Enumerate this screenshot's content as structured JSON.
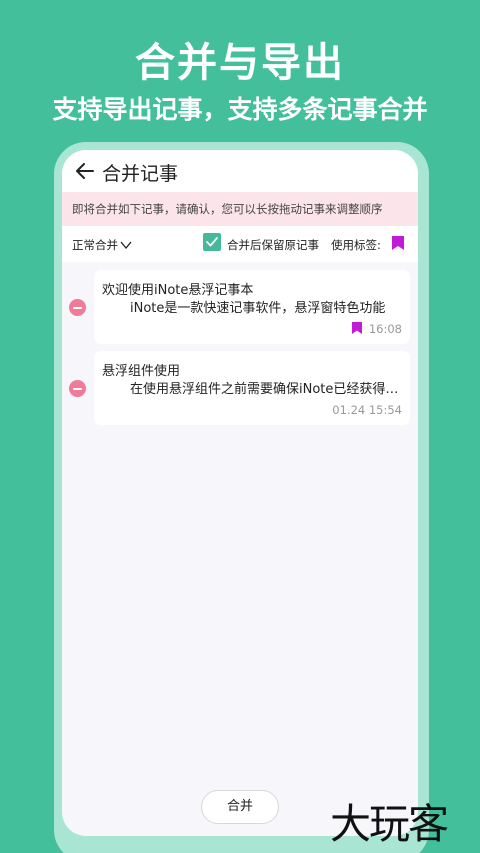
{
  "promo": {
    "title": "合并与导出",
    "subtitle": "支持导出记事，支持多条记事合并"
  },
  "header": {
    "back_icon": "arrow-left-icon",
    "title": "合并记事"
  },
  "notice": "即将合并如下记事，请确认，您可以长按拖动记事来调整顺序",
  "options": {
    "merge_mode": "正常合并",
    "keep_original_label": "合并后保留原记事",
    "keep_original_checked": true,
    "tag_label": "使用标签:",
    "tag_color": "#c21bd8"
  },
  "notes": [
    {
      "title": "欢迎使用iNote悬浮记事本",
      "body": "iNote是一款快速记事软件，悬浮窗特色功能",
      "time": "16:08",
      "has_tag": true
    },
    {
      "title": "悬浮组件使用",
      "body": "在使用悬浮组件之前需要确保iNote已经获得悬浮窗权限",
      "time": "01.24 15:54",
      "has_tag": false
    }
  ],
  "actions": {
    "merge_label": "合并"
  },
  "watermark": "大玩客",
  "colors": {
    "background": "#43bf9b",
    "accent": "#45b99a",
    "notice_bg": "#fbe4ea",
    "remove": "#ee7b97"
  }
}
